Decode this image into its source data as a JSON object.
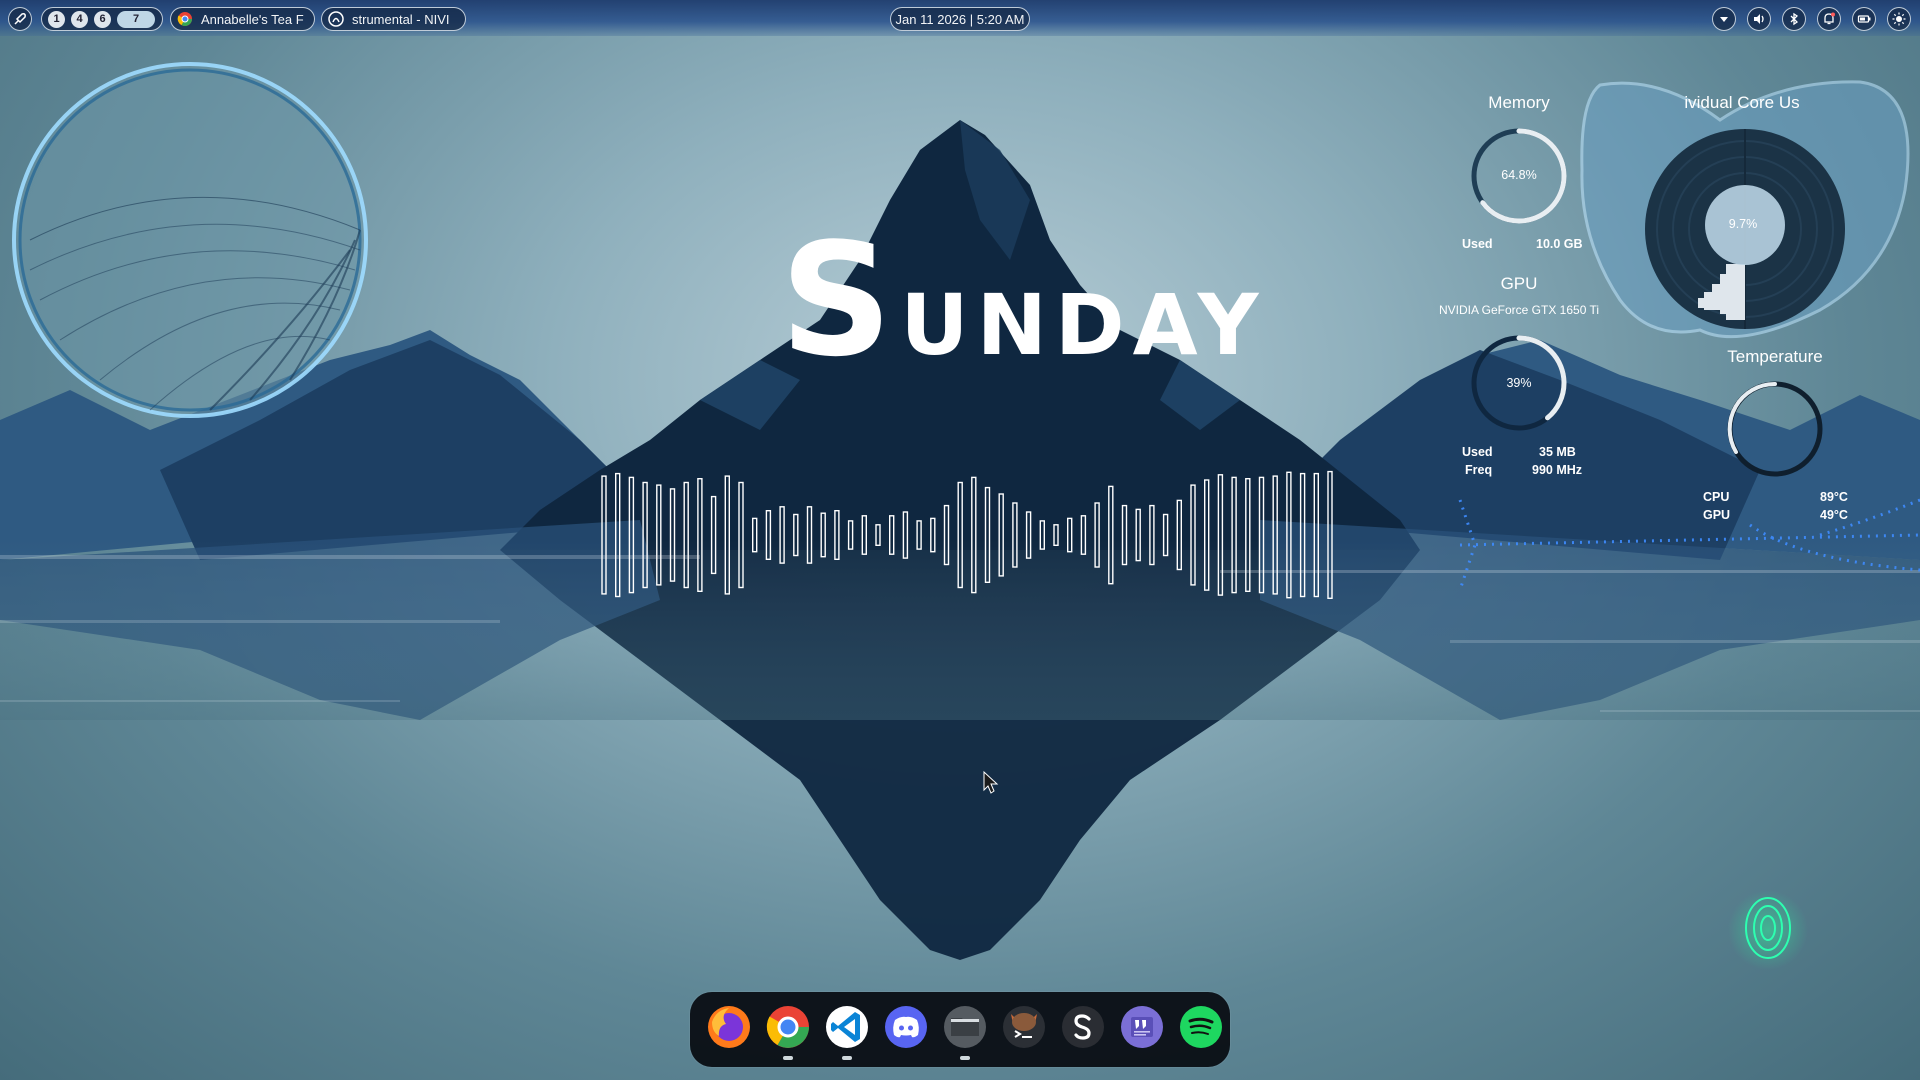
{
  "topbar": {
    "workspaces": [
      "1",
      "4",
      "6",
      "7"
    ],
    "active_workspace": "7",
    "windows": [
      {
        "title": "Annabelle's Tea F",
        "icon": "chrome-icon"
      },
      {
        "title": "strumental - NIVI",
        "icon": "media-player-icon"
      }
    ],
    "clock": "Jan 11 2026 | 5:20 AM",
    "tray_icons": [
      "chevron-down-icon",
      "volume-icon",
      "bluetooth-icon",
      "notification-bell-icon",
      "battery-icon",
      "brightness-icon"
    ]
  },
  "desktop": {
    "day_first_letter": "S",
    "day_rest": "UNDAY",
    "visualizer_bar_levels": [
      0.92,
      0.96,
      0.9,
      0.82,
      0.78,
      0.72,
      0.82,
      0.88,
      0.6,
      0.92,
      0.82,
      0.26,
      0.38,
      0.44,
      0.32,
      0.44,
      0.34,
      0.38,
      0.22,
      0.3,
      0.16,
      0.3,
      0.36,
      0.22,
      0.26,
      0.46,
      0.82,
      0.9,
      0.74,
      0.64,
      0.5,
      0.36,
      0.22,
      0.16,
      0.26,
      0.3,
      0.5,
      0.76,
      0.46,
      0.4,
      0.46,
      0.32,
      0.54,
      0.78,
      0.86,
      0.94,
      0.9,
      0.88,
      0.9,
      0.92,
      0.98,
      0.96,
      0.96,
      0.99
    ]
  },
  "widgets": {
    "memory": {
      "title": "Memory",
      "percent_label": "64.8%",
      "percent": 64.8,
      "used_label": "Used",
      "used_value": "10.0 GB"
    },
    "gpu": {
      "title": "GPU",
      "model": "NVIDIA GeForce GTX 1650 Ti",
      "percent_label": "39%",
      "percent": 39,
      "used_label": "Used",
      "used_value": "35 MB",
      "freq_label": "Freq",
      "freq_value": "990 MHz"
    },
    "cores": {
      "title": "ividual Core Us",
      "percent_label": "9.7%",
      "percent": 9.7
    },
    "temperature": {
      "title": "Temperature",
      "rows": [
        {
          "label": "CPU",
          "value": "89°C"
        },
        {
          "label": "GPU",
          "value": "49°C"
        }
      ]
    }
  },
  "dock": {
    "apps": [
      {
        "name": "firefox-icon",
        "running": false,
        "color": "#ff7a1a"
      },
      {
        "name": "chrome-icon",
        "running": true,
        "color": "#34a853"
      },
      {
        "name": "vscode-icon",
        "running": true,
        "color": "#0a84d6"
      },
      {
        "name": "discord-icon",
        "running": false,
        "color": "#5865f2"
      },
      {
        "name": "files-icon",
        "running": true,
        "color": "#555b61"
      },
      {
        "name": "terminal-icon",
        "running": false,
        "color": "#8a5a3b"
      },
      {
        "name": "stremio-icon",
        "running": false,
        "color": "#2a2d33"
      },
      {
        "name": "quotes-app-icon",
        "running": false,
        "color": "#7b6fd6"
      },
      {
        "name": "spotify-icon",
        "running": false,
        "color": "#1ed760"
      }
    ]
  },
  "colors": {
    "accent": "#4fa3ff",
    "mountain": "#0f2740",
    "mountain_light": "#3f6f98",
    "dock_bg": "#0a0e14"
  }
}
